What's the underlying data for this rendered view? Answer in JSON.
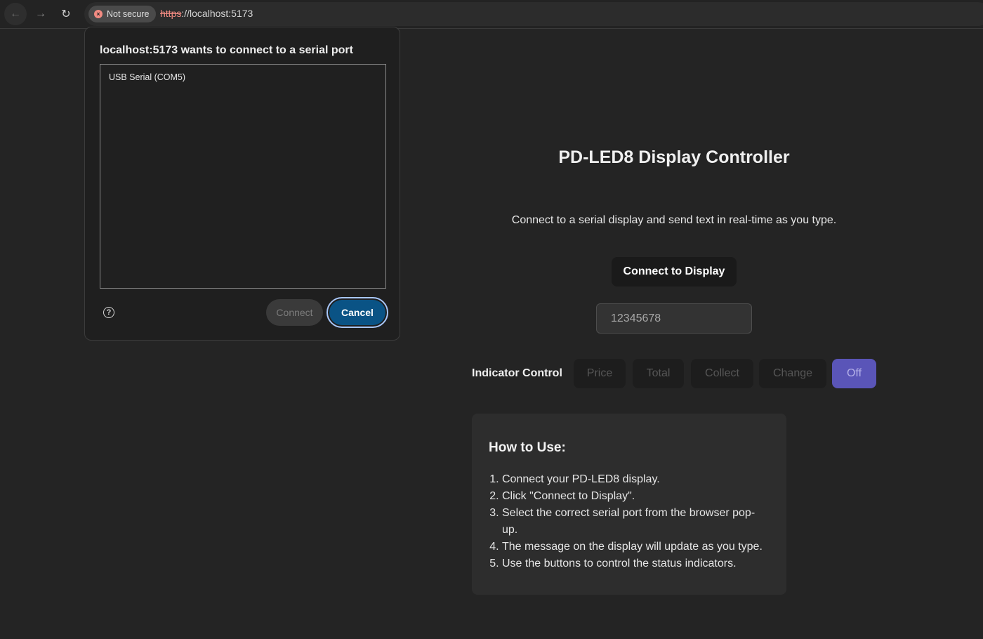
{
  "browser": {
    "security_chip": "Not secure",
    "url_scheme": "https",
    "url_rest": "://localhost:5173",
    "icons": {
      "back": "arrow-left-icon",
      "forward": "arrow-right-icon",
      "reload": "reload-icon"
    }
  },
  "page": {
    "title": "PD-LED8 Display Controller",
    "description": "Connect to a serial display and send text in real-time as you type.",
    "connect_button": "Connect to Display",
    "text_input_placeholder": "12345678",
    "indicator_label": "Indicator Control",
    "indicator_buttons": [
      "Price",
      "Total",
      "Collect",
      "Change",
      "Off"
    ],
    "active_indicator": "Off",
    "how_to": {
      "title": "How to Use:",
      "steps": [
        "Connect your PD-LED8 display.",
        "Click \"Connect to Display\".",
        "Select the correct serial port from the browser pop-up.",
        "The message on the display will update as you type.",
        "Use the buttons to control the status indicators."
      ]
    }
  },
  "dialog": {
    "title": "localhost:5173 wants to connect to a serial port",
    "ports": [
      "USB Serial (COM5)"
    ],
    "connect_label": "Connect",
    "cancel_label": "Cancel"
  },
  "colors": {
    "accent": "#5a55b8",
    "cancel_bg": "#0a5385",
    "focus_ring": "#a8c7fa",
    "warning": "#f28b82"
  }
}
